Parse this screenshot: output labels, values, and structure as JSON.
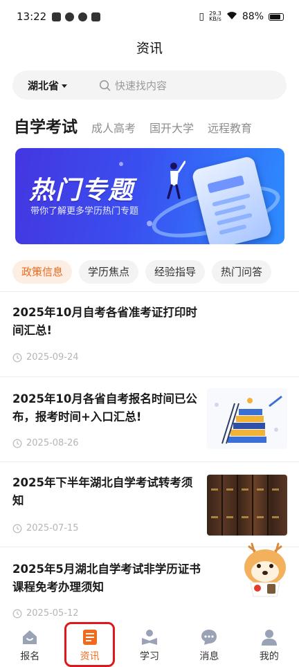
{
  "status_bar": {
    "time": "13:22",
    "speed_value": "29.3",
    "speed_unit": "KB/s",
    "battery": "88%"
  },
  "header": {
    "title": "资讯"
  },
  "search": {
    "province": "湖北省",
    "placeholder": "快速找内容"
  },
  "category_tabs": [
    {
      "label": "自学考试",
      "active": true
    },
    {
      "label": "成人高考",
      "active": false
    },
    {
      "label": "国开大学",
      "active": false
    },
    {
      "label": "远程教育",
      "active": false
    }
  ],
  "banner": {
    "title": "热门专题",
    "subtitle": "带你了解更多学历热门专题"
  },
  "pill_tabs": [
    {
      "label": "政策信息",
      "active": true
    },
    {
      "label": "学历焦点",
      "active": false
    },
    {
      "label": "经验指导",
      "active": false
    },
    {
      "label": "热门问答",
      "active": false
    }
  ],
  "articles": [
    {
      "title_line1": "2025年10月自考各省准考证打印时",
      "title_line2": "间汇总!",
      "date": "2025-09-24",
      "thumbnail": "none"
    },
    {
      "title_line1": "2025年10月各省自考报名时间已公",
      "title_line2": "布，报考时间+入口汇总!",
      "date": "2025-08-26",
      "thumbnail": "books-illustration"
    },
    {
      "title_line1": "2025年下半年湖北自学考试转考须",
      "title_line2": "知",
      "date": "2025-07-15",
      "thumbnail": "encyclopedia-books-photo"
    },
    {
      "title_line1": "2025年5月湖北自学考试非学历证书",
      "title_line2": "课程免考办理须知",
      "date": "2025-05-12",
      "thumbnail": "none"
    }
  ],
  "bottom_nav": [
    {
      "label": "报名",
      "icon": "register-house-icon",
      "active": false
    },
    {
      "label": "资讯",
      "icon": "news-document-icon",
      "active": true
    },
    {
      "label": "学习",
      "icon": "study-reading-icon",
      "active": false
    },
    {
      "label": "消息",
      "icon": "message-bubble-icon",
      "active": false
    },
    {
      "label": "我的",
      "icon": "profile-person-icon",
      "active": false
    }
  ],
  "colors": {
    "accent": "#f06a1c",
    "highlight_box": "#e0161a",
    "banner_start": "#4436e0",
    "banner_end": "#2d8cff"
  }
}
